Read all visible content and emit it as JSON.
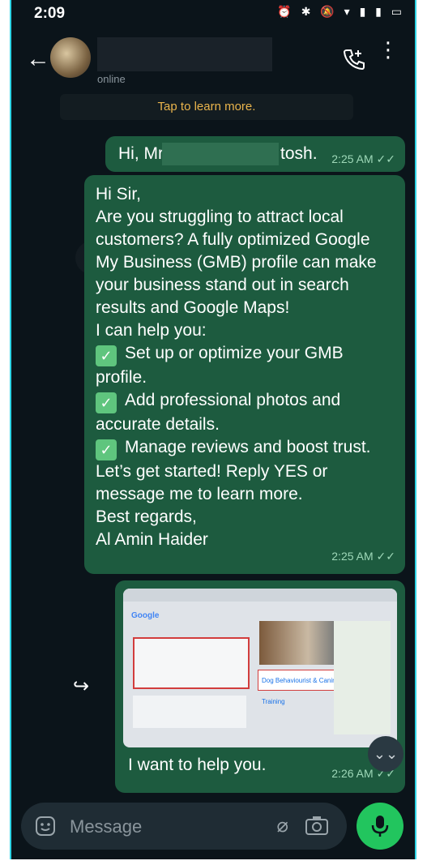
{
  "status_bar": {
    "time": "2:09",
    "indicators": "O G ✓",
    "right_icons": "⏰ ✱ 🔕 ▾ ▮ ▮ ▭"
  },
  "header": {
    "contact_status": "online",
    "back_icon": "back-arrow-icon",
    "call_icon": "add-call-icon",
    "menu_icon": "overflow-menu-icon"
  },
  "banner": {
    "text": "Tap to learn more."
  },
  "messages": [
    {
      "text_prefix": "Hi, Mr",
      "text_suffix": "tosh.",
      "time": "2:25 AM"
    },
    {
      "lines": [
        "Hi Sir,",
        "Are you struggling to attract local",
        "customers? A fully optimized Google",
        "My Business (GMB) profile can make",
        "your business stand out in search",
        "results and Google Maps!",
        "I can help you:"
      ],
      "bullets": [
        [
          "Set up or optimize your GMB",
          "profile."
        ],
        [
          "Add professional photos and",
          "accurate details."
        ],
        [
          "Manage reviews and boost trust."
        ]
      ],
      "closing": [
        "Let’s get started! Reply YES or",
        "message me to learn more.",
        "Best regards,",
        "Al Amin Haider"
      ],
      "time": "2:25 AM"
    },
    {
      "image_title": "Dog Behaviourist & Canine Training",
      "caption": "I want to help you.",
      "time": "2:26 AM"
    }
  ],
  "input": {
    "placeholder": "Message"
  },
  "colors": {
    "outgoing_bubble": "#1d5b3f",
    "background": "#0b141a",
    "accent_green": "#22c55e",
    "banner_text": "#e9b44c"
  }
}
